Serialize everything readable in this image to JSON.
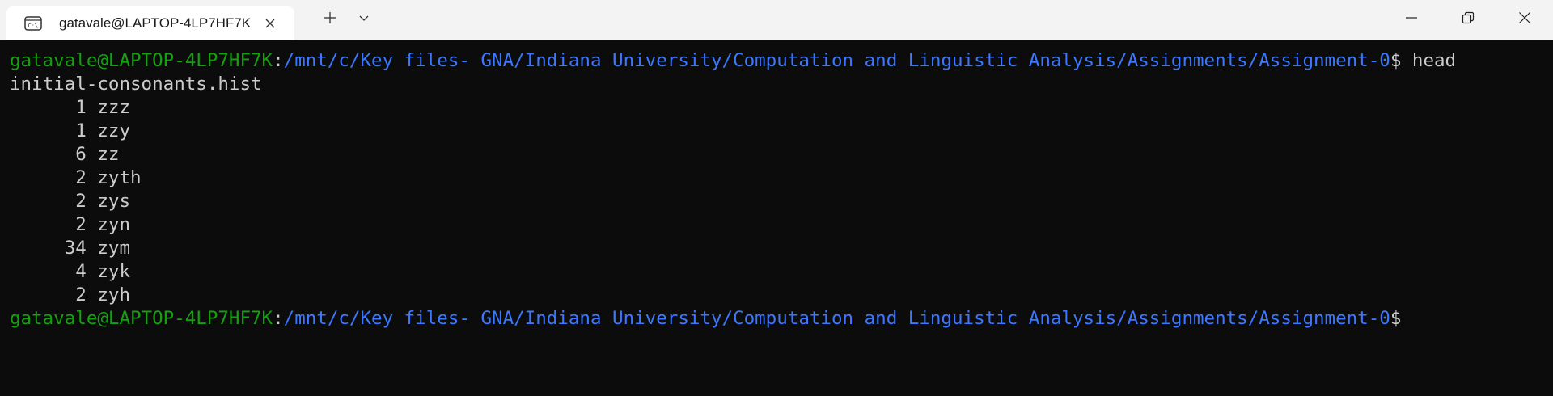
{
  "window": {
    "tab_title": "gatavale@LAPTOP-4LP7HF7K",
    "tab_icon": "terminal-icon",
    "icons": {
      "close_tab": "close-icon",
      "new_tab": "plus-icon",
      "dropdown": "chevron-down-icon",
      "minimize": "minimize-icon",
      "maximize": "restore-icon",
      "close_window": "close-icon"
    }
  },
  "colors": {
    "background": "#0c0c0c",
    "titlebar": "#f3f3f3",
    "prompt_user": "#13a10e",
    "prompt_path": "#3b78ff",
    "text": "#cccccc"
  },
  "terminal": {
    "prompt1": {
      "user_host": "gatavale@LAPTOP-4LP7HF7K",
      "separator": ":",
      "path": "/mnt/c/Key files- GNA/Indiana University/Computation and Linguistic Analysis/Assignments/Assignment-0",
      "dollar": "$",
      "command": " head"
    },
    "wrap_line": "initial-consonants.hist",
    "output": [
      {
        "count": "1",
        "text": "zzz"
      },
      {
        "count": "1",
        "text": "zzy"
      },
      {
        "count": "6",
        "text": "zz"
      },
      {
        "count": "2",
        "text": "zyth"
      },
      {
        "count": "2",
        "text": "zys"
      },
      {
        "count": "2",
        "text": "zyn"
      },
      {
        "count": "34",
        "text": "zym"
      },
      {
        "count": "4",
        "text": "zyk"
      },
      {
        "count": "2",
        "text": "zyh"
      }
    ],
    "prompt2": {
      "user_host": "gatavale@LAPTOP-4LP7HF7K",
      "separator": ":",
      "path": "/mnt/c/Key files- GNA/Indiana University/Computation and Linguistic Analysis/Assignments/Assignment-0",
      "dollar": "$"
    }
  }
}
